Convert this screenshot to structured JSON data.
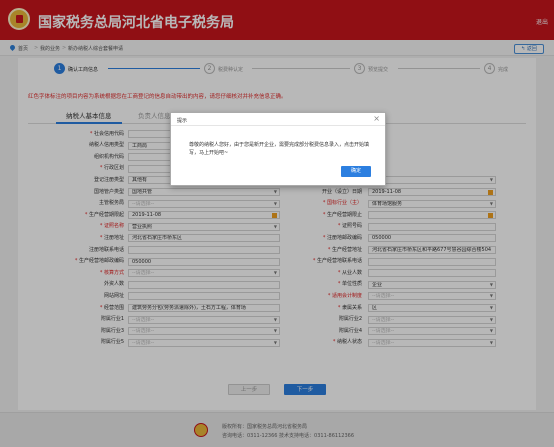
{
  "header": {
    "title": "国家税务总局河北省电子税务局",
    "exit": "退出"
  },
  "breadcrumb": {
    "items": [
      "首页",
      "我的业务",
      "新办纳税人综合套餐申请"
    ],
    "back": "返回"
  },
  "steps": [
    {
      "num": "1",
      "label": "确认工商信息"
    },
    {
      "num": "2",
      "label": "税费种认定"
    },
    {
      "num": "3",
      "label": "预览提交"
    },
    {
      "num": "4",
      "label": "完成"
    }
  ],
  "notice": "红色字体标注的项目内容为系统根据您在工商登记的信息自动带出的内容，请您仔细核对并补充信息正确。",
  "tabs": [
    "纳税人基本信息",
    "负责人信息"
  ],
  "left_fields": [
    {
      "label": "社会信用代码",
      "value": "",
      "type": "text",
      "req": true,
      "red": false
    },
    {
      "label": "纳税人信用类型",
      "value": "工商局",
      "type": "text",
      "req": false,
      "red": false
    },
    {
      "label": "组织机构代码",
      "value": "",
      "type": "text",
      "req": false,
      "red": false
    },
    {
      "label": "行政区划",
      "value": "",
      "type": "select",
      "req": true,
      "red": false
    },
    {
      "label": "登记注册类型",
      "value": "其他有",
      "type": "select",
      "req": false,
      "red": false
    },
    {
      "label": "国地管户类型",
      "value": "国地共管",
      "type": "select",
      "req": false,
      "red": false
    },
    {
      "label": "主管税务局",
      "value": "--请选择--",
      "type": "select",
      "req": false,
      "red": false
    },
    {
      "label": "生产经营期限起",
      "value": "2019-11-08",
      "type": "date",
      "req": true,
      "red": false
    },
    {
      "label": "证照名称",
      "value": "营业执照",
      "type": "select",
      "req": true,
      "red": true
    },
    {
      "label": "注册地址",
      "value": "河北省石家庄市桥东区",
      "type": "text",
      "req": true,
      "red": false
    },
    {
      "label": "注册地联系电话",
      "value": "",
      "type": "text",
      "req": false,
      "red": false
    },
    {
      "label": "生产经营地邮政编码",
      "value": "050000",
      "type": "text",
      "req": true,
      "red": false
    },
    {
      "label": "核算方式",
      "value": "--请选择--",
      "type": "select",
      "req": true,
      "red": true
    },
    {
      "label": "外资人数",
      "value": "",
      "type": "text",
      "req": false,
      "red": false
    },
    {
      "label": "网站网址",
      "value": "",
      "type": "text",
      "req": false,
      "red": false
    },
    {
      "label": "经营范围",
      "value": "建筑劳务分包(劳务派遣除外)，土石方工程，体育场",
      "type": "text",
      "req": true,
      "red": false
    },
    {
      "label": "附属行业1",
      "value": "--请选择--",
      "type": "select",
      "req": false,
      "red": false
    },
    {
      "label": "附属行业3",
      "value": "--请选择--",
      "type": "select",
      "req": false,
      "red": false
    },
    {
      "label": "附属行业5",
      "value": "--请选择--",
      "type": "select",
      "req": false,
      "red": false
    }
  ],
  "right_fields": [
    {
      "label": "",
      "value": "",
      "type": "blank",
      "req": false,
      "red": false
    },
    {
      "label": "",
      "value": "",
      "type": "blank",
      "req": false,
      "red": false
    },
    {
      "label": "",
      "value": "",
      "type": "blank",
      "req": false,
      "red": false
    },
    {
      "label": "",
      "value": "",
      "type": "blank",
      "req": false,
      "red": false
    },
    {
      "label": "",
      "value": "",
      "type": "select",
      "req": false,
      "red": false
    },
    {
      "label": "开业（设立）日期",
      "value": "2019-11-08",
      "type": "date",
      "req": false,
      "red": false
    },
    {
      "label": "国标行业（主）",
      "value": "体育场馆服务",
      "type": "select",
      "req": true,
      "red": true
    },
    {
      "label": "生产经营期限止",
      "value": "",
      "type": "date",
      "req": true,
      "red": false
    },
    {
      "label": "证照号码",
      "value": "",
      "type": "text",
      "req": true,
      "red": false
    },
    {
      "label": "注册地邮政编码",
      "value": "050000",
      "type": "text",
      "req": true,
      "red": false
    },
    {
      "label": "生产经营地址",
      "value": "河北省石家庄市桥东区和平路677号慧谷园综合楼504",
      "type": "text",
      "req": true,
      "red": false
    },
    {
      "label": "生产经营地联系电话",
      "value": "",
      "type": "text",
      "req": true,
      "red": false
    },
    {
      "label": "从业人数",
      "value": "",
      "type": "text",
      "req": true,
      "red": false
    },
    {
      "label": "单位性质",
      "value": "企业",
      "type": "select",
      "req": true,
      "red": false
    },
    {
      "label": "适用会计制度",
      "value": "--请选择--",
      "type": "select",
      "req": true,
      "red": true
    },
    {
      "label": "隶属关系",
      "value": "区",
      "type": "select",
      "req": true,
      "red": false
    },
    {
      "label": "附属行业2",
      "value": "--请选择--",
      "type": "select",
      "req": false,
      "red": false
    },
    {
      "label": "附属行业4",
      "value": "--请选择--",
      "type": "select",
      "req": false,
      "red": false
    },
    {
      "label": "纳税人状态",
      "value": "--请选择--",
      "type": "select",
      "req": true,
      "red": false
    }
  ],
  "buttons": {
    "prev": "上一步",
    "next": "下一步"
  },
  "dialog": {
    "title": "提示",
    "close": "×",
    "message": "尊敬的纳税人您好，由于您是新开企业，需要完成部分税费信息录入，点击开始填写，马上开始吧~",
    "ok": "确定"
  },
  "footer": {
    "line1": "版权所有：国家税务总局河北省税务局",
    "line2": "咨询电话：0311-12366  技术支持电话：0311-86112366"
  },
  "colors": {
    "brand": "#c8161d",
    "accent": "#2c7fe0"
  }
}
